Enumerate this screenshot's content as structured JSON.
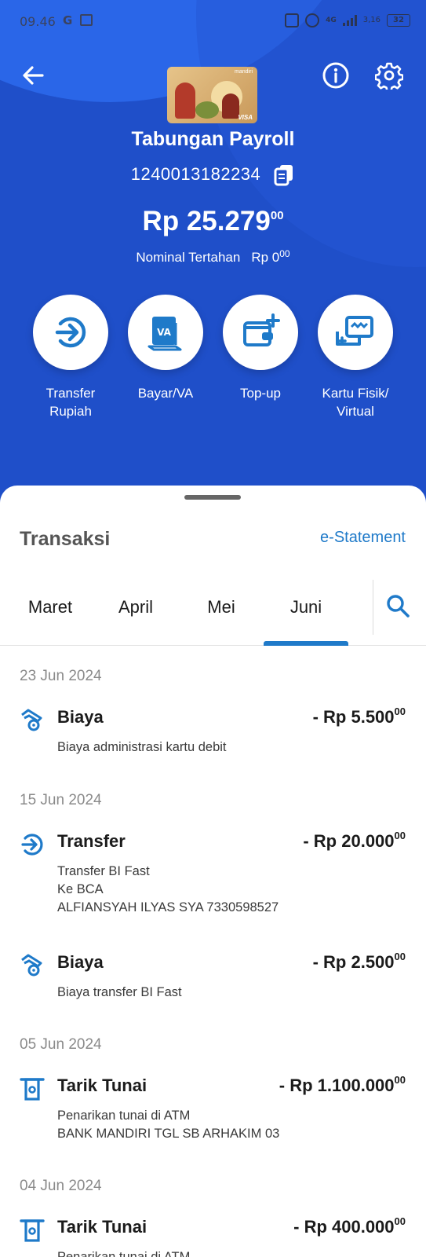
{
  "status_bar": {
    "time": "09.46",
    "google_icon": "G",
    "network": "4G",
    "speed": "3,16",
    "battery": "32"
  },
  "header": {
    "back_icon": "arrow-left-icon",
    "info_icon": "info-icon",
    "settings_icon": "gear-icon",
    "card_brand": "VISA",
    "account_name": "Tabungan Payroll",
    "account_number": "1240013182234",
    "balance_main": "Rp 25.279",
    "balance_cents": "00",
    "pending_label": "Nominal Tertahan",
    "pending_amount": "Rp 0",
    "pending_cents": "00",
    "colors": {
      "primary_blue": "#1f4fc9",
      "accent_blue": "#1f7ac9"
    }
  },
  "actions": [
    {
      "line1": "Transfer",
      "line2": "Rupiah",
      "icon": "transfer-icon"
    },
    {
      "line1": "Bayar/VA",
      "line2": "",
      "icon": "bill-va-icon"
    },
    {
      "line1": "Top-up",
      "line2": "",
      "icon": "wallet-topup-icon"
    },
    {
      "line1": "Kartu Fisik/",
      "line2": "Virtual",
      "icon": "card-icon"
    }
  ],
  "transactions_section": {
    "title": "Transaksi",
    "estatement": "e-Statement",
    "tabs": [
      "Maret",
      "April",
      "Mei",
      "Juni"
    ],
    "active_tab": "Juni",
    "search_icon": "search-icon"
  },
  "groups": [
    {
      "date": "23 Jun 2024",
      "items": [
        {
          "type": "fee",
          "name": "Biaya",
          "amount": "- Rp 5.500",
          "cents": "00",
          "desc": [
            "Biaya administrasi kartu debit"
          ]
        }
      ]
    },
    {
      "date": "15 Jun 2024",
      "items": [
        {
          "type": "transfer",
          "name": "Transfer",
          "amount": "- Rp 20.000",
          "cents": "00",
          "desc": [
            "Transfer BI Fast",
            "Ke BCA",
            "ALFIANSYAH ILYAS SYA 7330598527"
          ]
        },
        {
          "type": "fee",
          "name": "Biaya",
          "amount": "- Rp 2.500",
          "cents": "00",
          "desc": [
            "Biaya transfer BI Fast"
          ]
        }
      ]
    },
    {
      "date": "05 Jun 2024",
      "items": [
        {
          "type": "atm",
          "name": "Tarik Tunai",
          "amount": "- Rp 1.100.000",
          "cents": "00",
          "desc": [
            "Penarikan tunai di ATM",
            "BANK MANDIRI TGL SB ARHAKIM 03"
          ]
        }
      ]
    },
    {
      "date": "04 Jun 2024",
      "items": [
        {
          "type": "atm",
          "name": "Tarik Tunai",
          "amount": "- Rp 400.000",
          "cents": "00",
          "desc": [
            "Penarikan tunai di ATM"
          ]
        }
      ]
    }
  ]
}
